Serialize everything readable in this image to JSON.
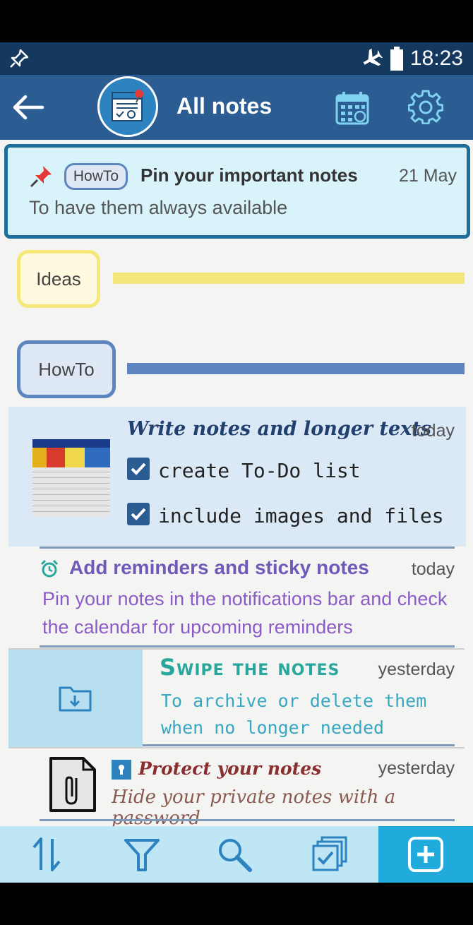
{
  "status_bar": {
    "time": "18:23"
  },
  "app_bar": {
    "title": "All notes"
  },
  "pinned_note": {
    "tag": "HowTo",
    "title": "Pin your important notes",
    "date": "21 May",
    "text": "To have them always available"
  },
  "groups": [
    {
      "label": "Ideas",
      "color": "#f3e67a"
    },
    {
      "label": "HowTo",
      "color": "#5d86bf"
    }
  ],
  "notes": [
    {
      "title": "Write notes and longer texts",
      "date": "today",
      "checklist": [
        "create To-Do list",
        "include images and files"
      ]
    },
    {
      "title": "Add reminders and sticky notes",
      "date": "today",
      "text": "Pin your notes in the notifications bar and check the calendar for upcoming reminders"
    },
    {
      "title": "Swipe the notes",
      "date": "yesterday",
      "text": "To archive or delete them when no longer needed"
    },
    {
      "title": "Protect your notes",
      "date": "yesterday",
      "text": "Hide your private notes with a password"
    }
  ],
  "colors": {
    "status_bar": "#14385e",
    "app_bar": "#2c5d92",
    "bottom_bar": "#bfe6f5",
    "add_button": "#21abdc"
  },
  "icons": [
    "pin-status-icon",
    "airplane-icon",
    "battery-icon",
    "back-arrow-icon",
    "app-logo-icon",
    "calendar-icon",
    "settings-gear-icon",
    "pushpin-icon",
    "alarm-clock-icon",
    "archive-folder-icon",
    "attachment-file-icon",
    "lock-icon",
    "sort-icon",
    "filter-icon",
    "search-icon",
    "multi-select-icon",
    "add-note-icon"
  ]
}
